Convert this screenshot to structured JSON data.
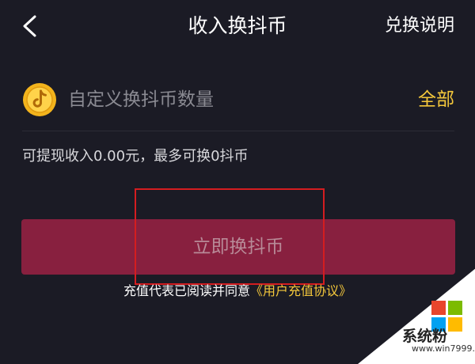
{
  "header": {
    "back_icon": "chevron-left-icon",
    "title": "收入换抖币",
    "help_link": "兑换说明"
  },
  "exchange_input": {
    "icon": "douyin-coin-icon",
    "value": "",
    "placeholder": "自定义换抖币数量",
    "all_label": "全部"
  },
  "balance_note": "可提现收入0.00元，最多可换0抖币",
  "exchange_button": {
    "label": "立即换抖币"
  },
  "agreement": {
    "text": "充值代表已阅读并同意",
    "link": "《用户充值协议》"
  },
  "watermark": {
    "text": "系统粉",
    "url": "www.win7999.com"
  },
  "colors": {
    "background": "#1b1b25",
    "accent_gold": "#f5c83b",
    "button_bg": "#88203f",
    "button_text": "#b88a97",
    "highlight_red": "#d41d20"
  }
}
